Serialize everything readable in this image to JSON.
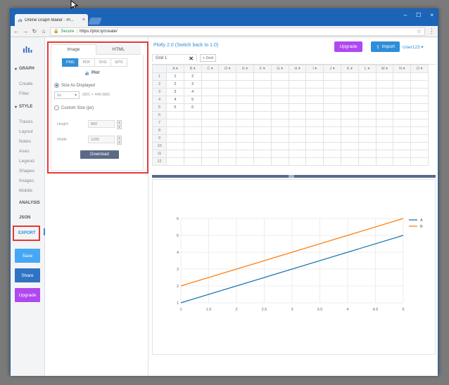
{
  "browser": {
    "tab_title": "Online Graph Maker · Pl...",
    "tab_close": "×",
    "secure_label": "Secure",
    "url": "https://plot.ly/create/",
    "minimize": "–",
    "maximize": "☐",
    "close": "×",
    "back": "←",
    "forward": "→",
    "reload": "↻",
    "home": "⌂",
    "star": "☆",
    "menu": "⋮"
  },
  "sidebar": {
    "sections": {
      "graph": "GRAPH",
      "style": "STYLE",
      "analysis": "ANALYSIS",
      "json": "JSON",
      "export": "EXPORT"
    },
    "graph_items": [
      "Create",
      "Filter"
    ],
    "style_items": [
      "Traces",
      "Layout",
      "Notes",
      "Axes",
      "Legend",
      "Shapes",
      "Images",
      "Mobile"
    ],
    "buttons": {
      "save": "Save",
      "share": "Share",
      "upgrade": "Upgrade"
    }
  },
  "export_panel": {
    "tabs": [
      "Image",
      "HTML"
    ],
    "formats": [
      "PNG",
      "PDF",
      "SVG",
      "EPS"
    ],
    "selected_format": "PNG",
    "plot_label": "Plot",
    "size_as_displayed": "Size As Displayed",
    "scale_value": "1x",
    "dims_text": "(801 × 449.688)",
    "custom_size": "Custom Size (px)",
    "height_label": "Height",
    "height_value": "800",
    "width_label": "Width",
    "width_value": "1200",
    "download": "Download"
  },
  "main": {
    "title": "Plotly 2.0 (Switch back to 1.0)",
    "upgrade": "Upgrade",
    "import": "Import",
    "user": "User123 ▾",
    "grid_tab": "Grid 1",
    "grid_tab_close": "✕",
    "add_grid": "+ Grid",
    "columns": [
      "A",
      "B",
      "C",
      "D",
      "E",
      "F",
      "G",
      "H",
      "I",
      "J",
      "K",
      "L",
      "M",
      "N",
      "O"
    ],
    "rows": [
      [
        "1",
        "2"
      ],
      [
        "2",
        "3"
      ],
      [
        "3",
        "4"
      ],
      [
        "4",
        "5"
      ],
      [
        "5",
        "6"
      ],
      [],
      [],
      [],
      [],
      [],
      [],
      []
    ]
  },
  "chart_data": {
    "type": "line",
    "x": [
      1,
      2,
      3,
      4,
      5
    ],
    "series": [
      {
        "name": "A",
        "values": [
          1,
          2,
          3,
          4,
          5
        ],
        "color": "#1f77b4"
      },
      {
        "name": "B",
        "values": [
          2,
          3,
          4,
          5,
          6
        ],
        "color": "#ff7f0e"
      }
    ],
    "xticks": [
      "1",
      "1.5",
      "2",
      "2.5",
      "3",
      "3.5",
      "4",
      "4.5",
      "5"
    ],
    "yticks": [
      "1",
      "2",
      "3",
      "4",
      "5",
      "6"
    ],
    "xlim": [
      1,
      5
    ],
    "ylim": [
      1,
      6
    ],
    "grid": true,
    "legend": "top-right"
  }
}
